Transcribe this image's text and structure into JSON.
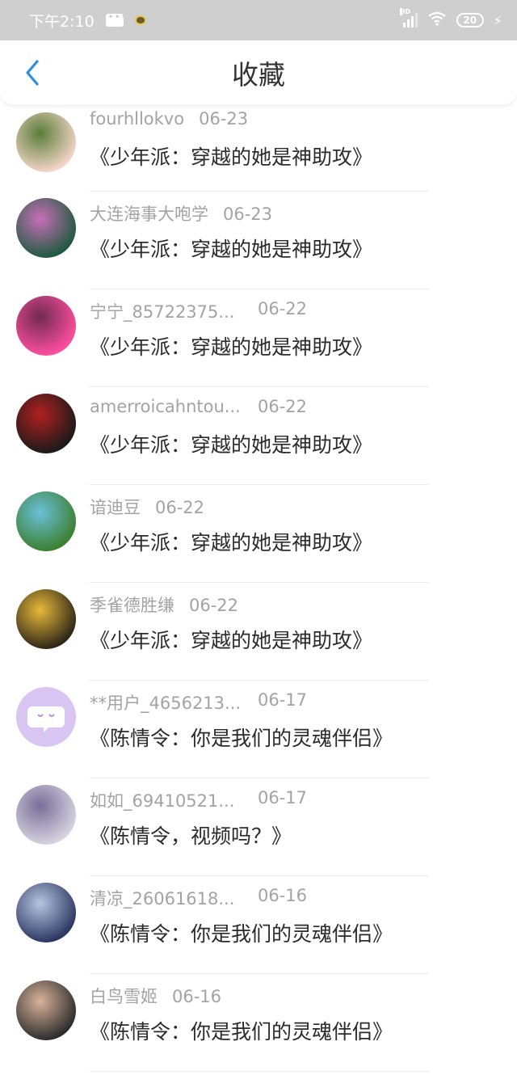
{
  "status_bar": {
    "time": "下午2:10",
    "battery": "20"
  },
  "nav": {
    "title": "收藏"
  },
  "items": [
    {
      "username": "fourhllokvo",
      "date": "06-23",
      "title": "《少年派：穿越的她是神助攻》",
      "avatar_colors": [
        "#f5d6c8",
        "#5a7d3a"
      ]
    },
    {
      "username": "大连海事大咆学",
      "date": "06-23",
      "title": "《少年派：穿越的她是神助攻》",
      "avatar_colors": [
        "#1d5a3e",
        "#c86fb8"
      ]
    },
    {
      "username": "宁宁_85722375...",
      "date": "06-22",
      "title": "《少年派：穿越的她是神助攻》",
      "avatar_colors": [
        "#ff4fa0",
        "#6e2b4f"
      ]
    },
    {
      "username": "amerroicahntou...",
      "date": "06-22",
      "title": "《少年派：穿越的她是神助攻》",
      "avatar_colors": [
        "#1a1a1a",
        "#b02020"
      ]
    },
    {
      "username": "谙迪豆",
      "date": "06-22",
      "title": "《少年派：穿越的她是神助攻》",
      "avatar_colors": [
        "#3b7f2e",
        "#6bbfd9"
      ]
    },
    {
      "username": "季雀德胜缣",
      "date": "06-22",
      "title": "《少年派：穿越的她是神助攻》",
      "avatar_colors": [
        "#2b2416",
        "#e7b93a"
      ]
    },
    {
      "username": "**用户_4656213...",
      "date": "06-17",
      "title": "《陈情令：你是我们的灵魂伴侣》",
      "avatar_colors": [
        "#d9c5f2",
        "#b491e0"
      ]
    },
    {
      "username": "如如_69410521...",
      "date": "06-17",
      "title": "《陈情令，视频吗？》",
      "avatar_colors": [
        "#d8d4e0",
        "#7a6e9a"
      ]
    },
    {
      "username": "清凉_26061618...",
      "date": "06-16",
      "title": "《陈情令：你是我们的灵魂伴侣》",
      "avatar_colors": [
        "#2a3560",
        "#b8c4e0"
      ]
    },
    {
      "username": "白鸟雪姬",
      "date": "06-16",
      "title": "《陈情令：你是我们的灵魂伴侣》",
      "avatar_colors": [
        "#2a2a2a",
        "#d9b39a"
      ]
    }
  ]
}
